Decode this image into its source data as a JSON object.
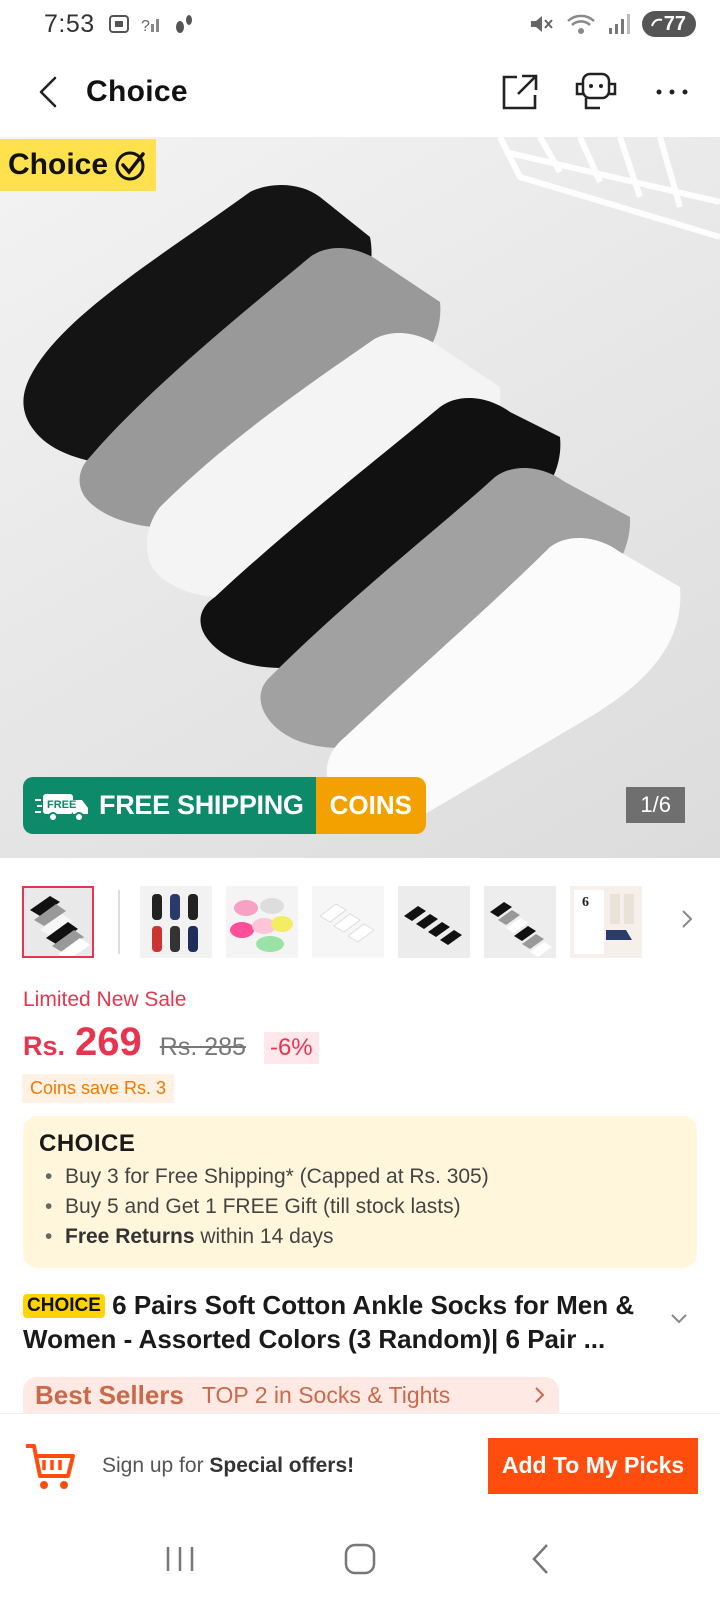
{
  "status_bar": {
    "time": "7:53",
    "battery": "77",
    "icons": [
      "screenshot-icon",
      "signal-icon",
      "footprint-icon",
      "mute-icon",
      "wifi-icon",
      "cell-signal-icon"
    ]
  },
  "header": {
    "title": "Choice",
    "icons": [
      "back-icon",
      "share-icon",
      "support-icon",
      "more-icon"
    ]
  },
  "hero": {
    "badge_label": "Choice",
    "free_tag": "FREE",
    "shipping_label": "FREE SHIPPING",
    "coins_label": "COINS",
    "counter": "1/6"
  },
  "thumbnails": {
    "count": 7,
    "active_index": 0,
    "thumb_6_label": "6"
  },
  "pricing": {
    "sale_label": "Limited New Sale",
    "currency": "Rs.",
    "price": "269",
    "old_price": "Rs. 285",
    "discount": "-6%",
    "coins_save": "Coins save Rs. 3"
  },
  "choice_box": {
    "logo": "CHOICE",
    "perks": [
      {
        "text": "Buy 3 for  Free Shipping* (Capped at Rs. 305)"
      },
      {
        "text": "Buy 5 and Get 1 FREE Gift (till stock lasts)"
      },
      {
        "bold": "Free Returns",
        "rest": " within 14 days"
      }
    ]
  },
  "product": {
    "tag": "CHOICE",
    "title": "6 Pairs Soft Cotton Ankle Socks for Men & Women - Assorted Colors (3 Random)| 6 Pair ..."
  },
  "best_sellers": {
    "title": "Best Sellers",
    "rank": "TOP 2 in Socks & Tights"
  },
  "bottom_bar": {
    "signup_prefix": "Sign up for ",
    "signup_bold": "Special offers!",
    "add_button": "Add To My Picks"
  },
  "colors": {
    "accent_red": "#e8354f",
    "cta_orange": "#ff4d0e",
    "choice_yellow": "#ffe14d",
    "shipping_green": "#0c8a6a",
    "coins_orange": "#f2a100"
  }
}
